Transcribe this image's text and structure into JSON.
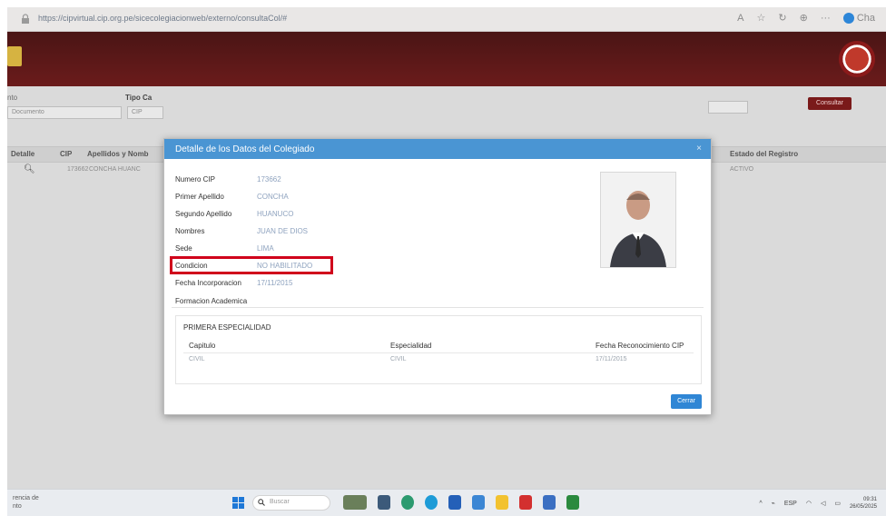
{
  "browser": {
    "url": "https://cipvirtual.cip.org.pe/sicecolegiacionweb/externo/consultaCol/#",
    "profile_label": "Cha"
  },
  "page": {
    "filters": {
      "label_a": "Tipo Ca",
      "label_b": "nto",
      "select_a_value": "Documento",
      "select_b_value": "CIP",
      "search_button": "Consultar"
    },
    "table": {
      "headers": [
        "Detalle",
        "CIP",
        "Apellidos y Nomb",
        "Estado del Registro"
      ],
      "row": {
        "cip": "173662",
        "name": "CONCHA HUANC",
        "estado": "ACTIVO"
      }
    }
  },
  "modal": {
    "title": "Detalle de los Datos del Colegiado",
    "fields": [
      {
        "label": "Numero CIP",
        "value": "173662"
      },
      {
        "label": "Primer Apellido",
        "value": "CONCHA"
      },
      {
        "label": "Segundo Apellido",
        "value": "HUANUCO"
      },
      {
        "label": "Nombres",
        "value": "JUAN DE DIOS"
      },
      {
        "label": "Sede",
        "value": "LIMA"
      },
      {
        "label": "Condicion",
        "value": "NO HABILITADO"
      },
      {
        "label": "Fecha Incorporacion",
        "value": "17/11/2015"
      }
    ],
    "formacion_label": "Formacion Academica",
    "especialidad": {
      "title": "PRIMERA ESPECIALIDAD",
      "columns": [
        "Capitulo",
        "Especialidad",
        "Fecha Reconocimiento CIP"
      ],
      "row": [
        "CIVIL",
        "CIVIL",
        "17/11/2015"
      ]
    },
    "close_button": "Cerrar"
  },
  "taskbar": {
    "left_text_1": "rencia de",
    "left_text_2": "nto",
    "search_placeholder": "Buscar",
    "language": "ESP",
    "time": "09:31",
    "date": "26/05/2025"
  },
  "colors": {
    "header_red": "#6b1b1b",
    "modal_blue": "#4a95d3",
    "highlight": "#d0021b"
  }
}
